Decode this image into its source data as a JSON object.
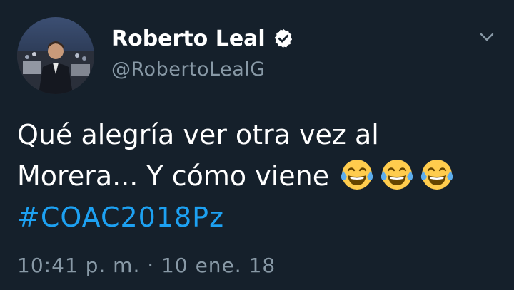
{
  "tweet": {
    "author": {
      "display_name": "Roberto Leal",
      "handle": "@RobertoLealG",
      "verified": true
    },
    "text_line_1": "Qué alegría ver otra vez al",
    "text_line_2": "Morera... Y cómo viene",
    "emoji": [
      "face-with-tears-of-joy",
      "face-with-tears-of-joy",
      "face-with-tears-of-joy"
    ],
    "hashtag": "#COAC2018Pz",
    "timestamp": "10:41 p. m. · 10 ene. 18"
  },
  "colors": {
    "background": "#15202b",
    "text": "#ffffff",
    "secondary": "#8899a6",
    "accent": "#1da1f2"
  }
}
